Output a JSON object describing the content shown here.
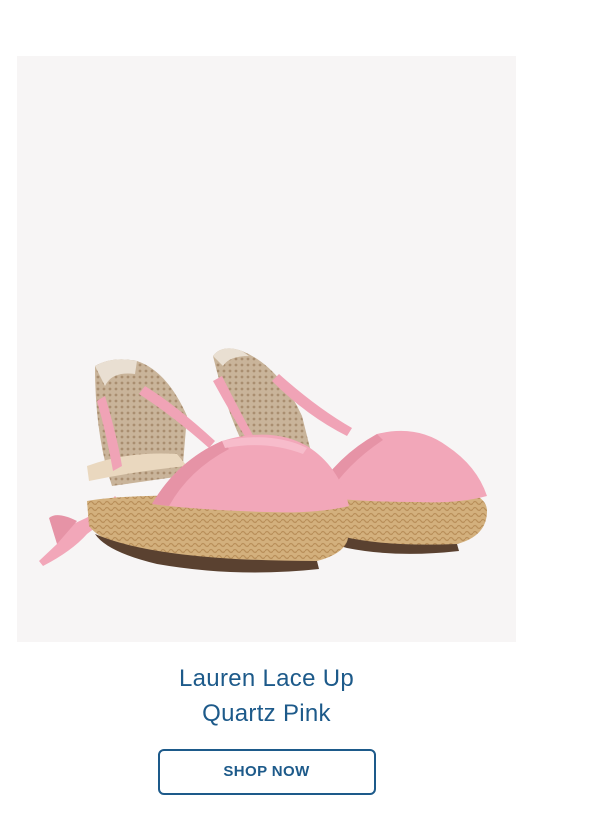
{
  "product": {
    "name_line1": "Lauren Lace Up",
    "name_line2": "Quartz Pink",
    "image_alt": "Pink lace-up espadrille sandals"
  },
  "cta": {
    "label": "SHOP NOW"
  },
  "colors": {
    "brand_blue": "#1d5a8a",
    "image_background": "#f7f5f5",
    "canvas_pink": "#f2a7b9",
    "jute": "#d4b07e"
  }
}
